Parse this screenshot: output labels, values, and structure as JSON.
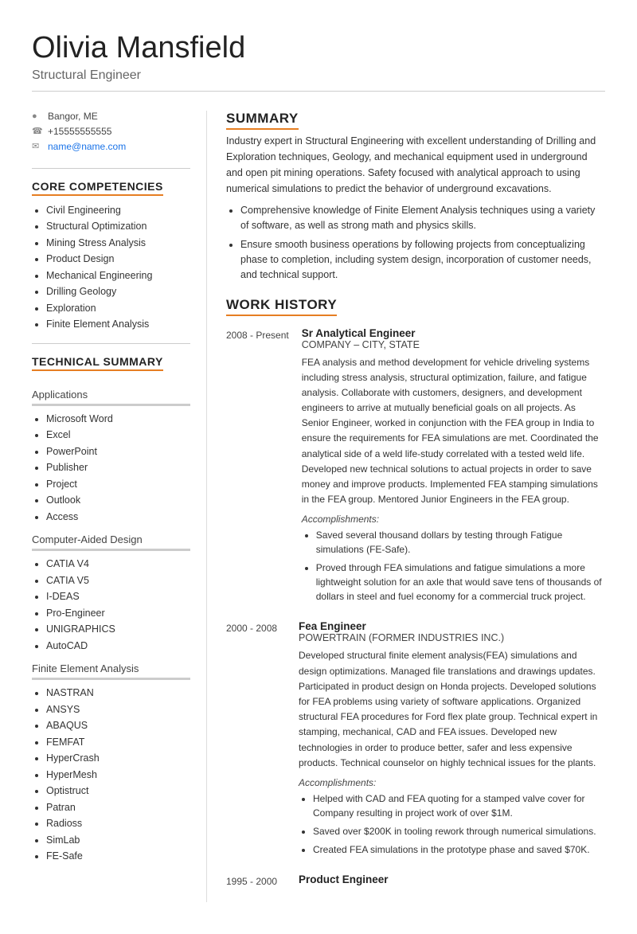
{
  "header": {
    "name": "Olivia Mansfield",
    "title": "Structural Engineer"
  },
  "contact": {
    "location": "Bangor, ME",
    "phone": "+15555555555",
    "email": "name@name.com"
  },
  "core_competencies": {
    "section_title": "CORE COMPETENCIES",
    "items": [
      "Civil Engineering",
      "Structural Optimization",
      "Mining Stress Analysis",
      "Product Design",
      "Mechanical Engineering",
      "Drilling Geology",
      "Exploration",
      "Finite Element Analysis"
    ]
  },
  "technical_summary": {
    "section_title": "TECHNICAL SUMMARY",
    "applications": {
      "title": "Applications",
      "items": [
        "Microsoft Word",
        "Excel",
        "PowerPoint",
        "Publisher",
        "Project",
        "Outlook",
        "Access"
      ]
    },
    "cad": {
      "title": "Computer-Aided Design",
      "items": [
        "CATIA V4",
        "CATIA V5",
        "I-DEAS",
        "Pro-Engineer",
        "UNIGRAPHICS",
        "AutoCAD"
      ]
    },
    "fea": {
      "title": "Finite Element Analysis",
      "items": [
        "NASTRAN",
        "ANSYS",
        "ABAQUS",
        "FEMFAT",
        "HyperCrash",
        "HyperMesh",
        "Optistruct",
        "Patran",
        "Radioss",
        "SimLab",
        "FE-Safe"
      ]
    }
  },
  "summary": {
    "section_title": "SUMMARY",
    "paragraph": "Industry expert in Structural Engineering with excellent understanding of Drilling and Exploration techniques, Geology, and mechanical equipment used in underground and open pit mining operations. Safety focused with analytical approach to using numerical simulations to predict the behavior of underground excavations.",
    "bullets": [
      "Comprehensive knowledge of Finite Element Analysis techniques using a variety of software, as well as strong math and physics skills.",
      "Ensure smooth business operations by following projects from conceptualizing phase to completion, including system design, incorporation of customer needs, and technical support."
    ]
  },
  "work_history": {
    "section_title": "WORK HISTORY",
    "entries": [
      {
        "date": "2008 - Present",
        "title": "Sr Analytical Engineer",
        "company": "COMPANY – CITY, STATE",
        "description": "FEA analysis and method development for vehicle driveling systems including stress analysis, structural optimization, failure, and fatigue analysis. Collaborate with customers, designers, and development engineers to arrive at mutually beneficial goals on all projects. As Senior Engineer, worked in conjunction with the FEA group in India to ensure the requirements for FEA simulations are met. Coordinated the analytical side of a weld life-study correlated with a tested weld life. Developed new technical solutions to actual projects in order to save money and improve products. Implemented FEA stamping simulations in the FEA group. Mentored Junior Engineers in the FEA group.",
        "accomplishments_label": "Accomplishments:",
        "accomplishments": [
          "Saved several thousand dollars by testing through Fatigue simulations (FE-Safe).",
          "Proved through FEA simulations and fatigue simulations a more lightweight solution for an axle that would save tens of thousands of dollars in steel and fuel economy for a commercial truck project."
        ]
      },
      {
        "date": "2000 - 2008",
        "title": "Fea Engineer",
        "company": "POWERTRAIN (FORMER INDUSTRIES INC.)",
        "description": "Developed structural finite element analysis(FEA) simulations and design optimizations. Managed file translations and drawings updates. Participated in product design on Honda projects. Developed solutions for FEA problems using variety of software applications. Organized structural FEA procedures for Ford flex plate group. Technical expert in stamping, mechanical, CAD and FEA issues. Developed new technologies in order to produce better, safer and less expensive products. Technical counselor on highly technical issues for the plants.",
        "accomplishments_label": "Accomplishments:",
        "accomplishments": [
          "Helped with CAD and FEA quoting for a stamped valve cover for Company resulting in project work of over $1M.",
          "Saved over $200K in tooling rework through numerical simulations.",
          "Created FEA simulations in the prototype phase and saved $70K."
        ]
      },
      {
        "date": "1995 - 2000",
        "title": "Product Engineer",
        "company": "",
        "description": "",
        "accomplishments_label": "",
        "accomplishments": []
      }
    ]
  }
}
